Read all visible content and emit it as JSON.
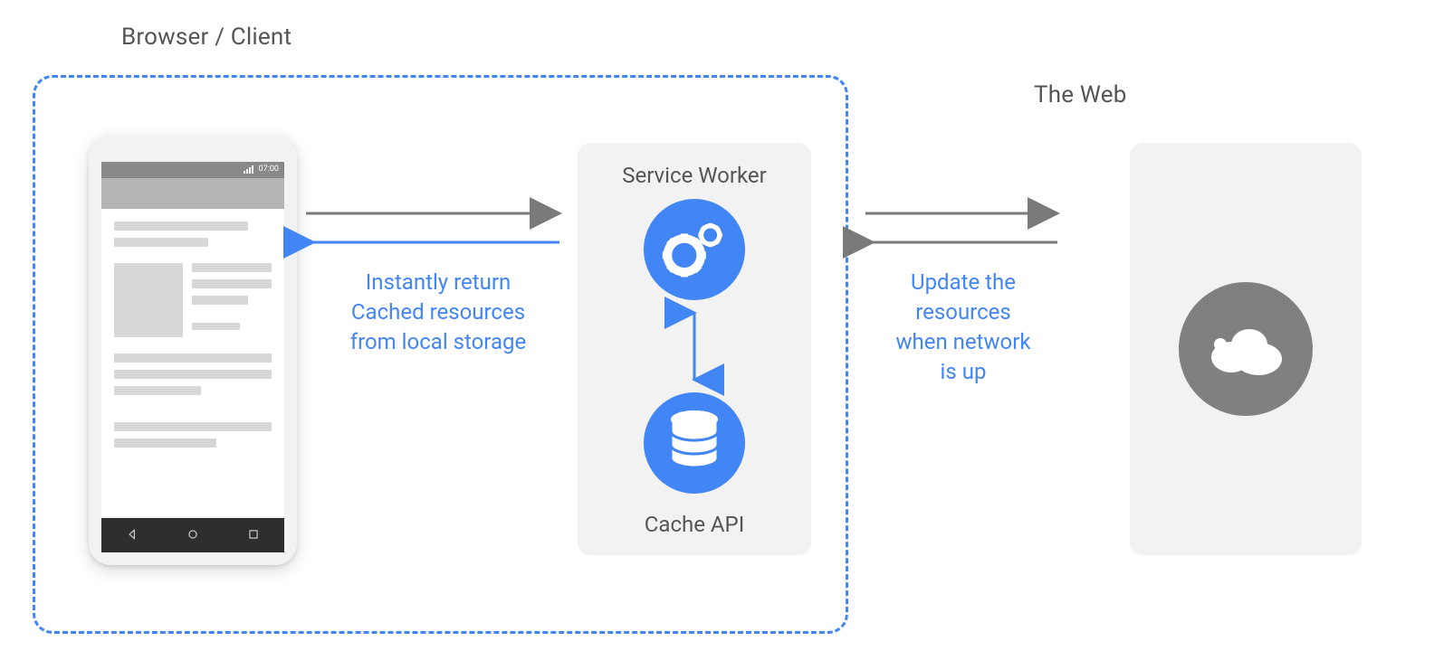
{
  "titles": {
    "browser_client": "Browser / Client",
    "the_web": "The Web"
  },
  "phone": {
    "status_time": "07:00"
  },
  "service_worker": {
    "label": "Service Worker",
    "cache_label": "Cache API"
  },
  "annotations": {
    "cached": {
      "line1": "Instantly return",
      "line2": "Cached resources",
      "line3": "from local storage"
    },
    "update": {
      "line1": "Update the",
      "line2": "resources",
      "line3": "when network",
      "line4": "is up"
    }
  },
  "colors": {
    "accent": "#4285f4",
    "gray_text": "#555555",
    "cloud_bg": "#808080"
  }
}
